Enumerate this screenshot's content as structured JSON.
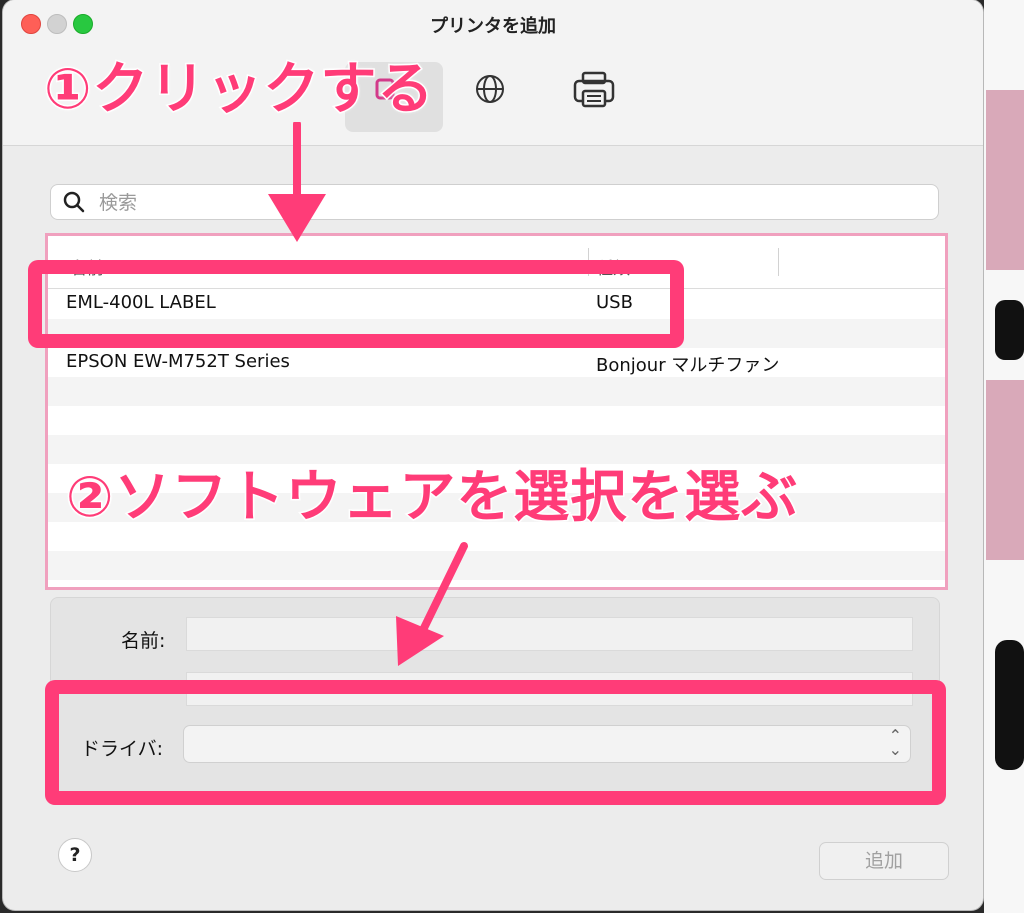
{
  "window": {
    "title": "プリンタを追加"
  },
  "search": {
    "placeholder": "検索"
  },
  "printer_list": {
    "headers": {
      "name": "名前",
      "kind": "種類"
    },
    "rows": [
      {
        "name": "EML-400L LABEL",
        "kind": "USB"
      },
      {
        "name": "EPSON EW-M752T Series",
        "kind": "Bonjour マルチファン"
      }
    ]
  },
  "form": {
    "name_label": "名前:",
    "driver_label": "ドライバ:"
  },
  "buttons": {
    "help": "?",
    "add": "追加"
  },
  "annotations": {
    "step1": "①クリックする",
    "step2": "②ソフトウェアを選択を選ぶ",
    "color": "#ff3c78"
  },
  "colors": {
    "accent": "#ff3c78",
    "close": "#fe5f57",
    "maximize": "#28c840"
  }
}
